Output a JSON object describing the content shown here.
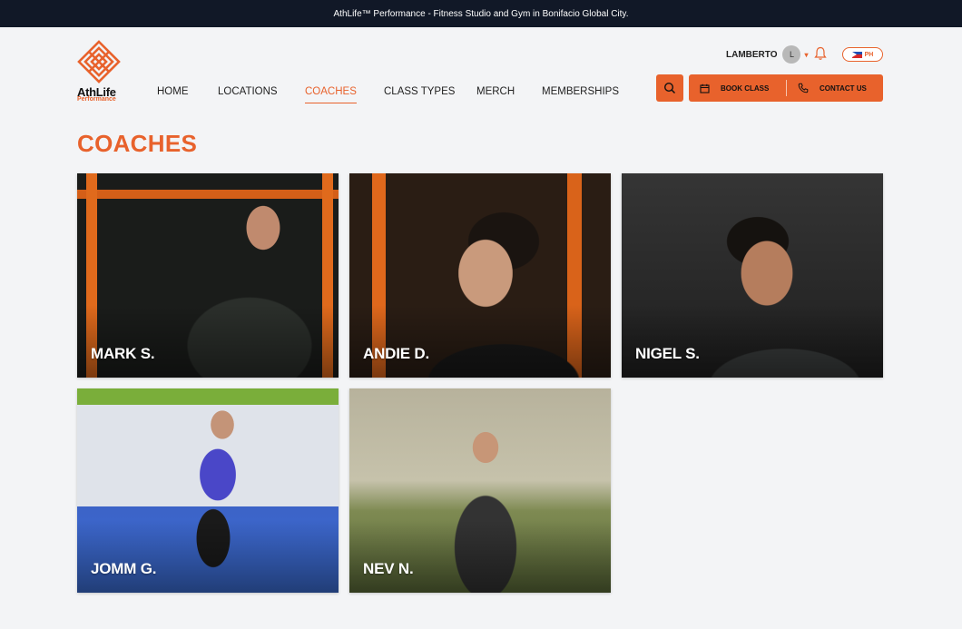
{
  "announcement": "AthLife™ Performance - Fitness Studio and Gym in Bonifacio Global City.",
  "logo": {
    "name": "AthLife",
    "subtitle": "Performance"
  },
  "nav": [
    "HOME",
    "LOCATIONS",
    "COACHES",
    "CLASS TYPES",
    "MERCH",
    "MEMBERSHIPS"
  ],
  "nav_active": "COACHES",
  "user": {
    "name": "LAMBERTO",
    "initial": "L"
  },
  "language": "PH",
  "actions": {
    "book": "BOOK CLASS",
    "contact": "CONTACT US"
  },
  "page_title": "COACHES",
  "coaches": [
    "MARK S.",
    "ANDIE D.",
    "NIGEL S.",
    "JOMM G.",
    "NEV N."
  ],
  "colors": {
    "accent": "#e8622c",
    "topbar": "#111827",
    "background": "#f3f4f6"
  },
  "icons": [
    "search-icon",
    "calendar-icon",
    "phone-icon",
    "bell-icon",
    "chevron-down-icon",
    "ph-flag-icon"
  ]
}
